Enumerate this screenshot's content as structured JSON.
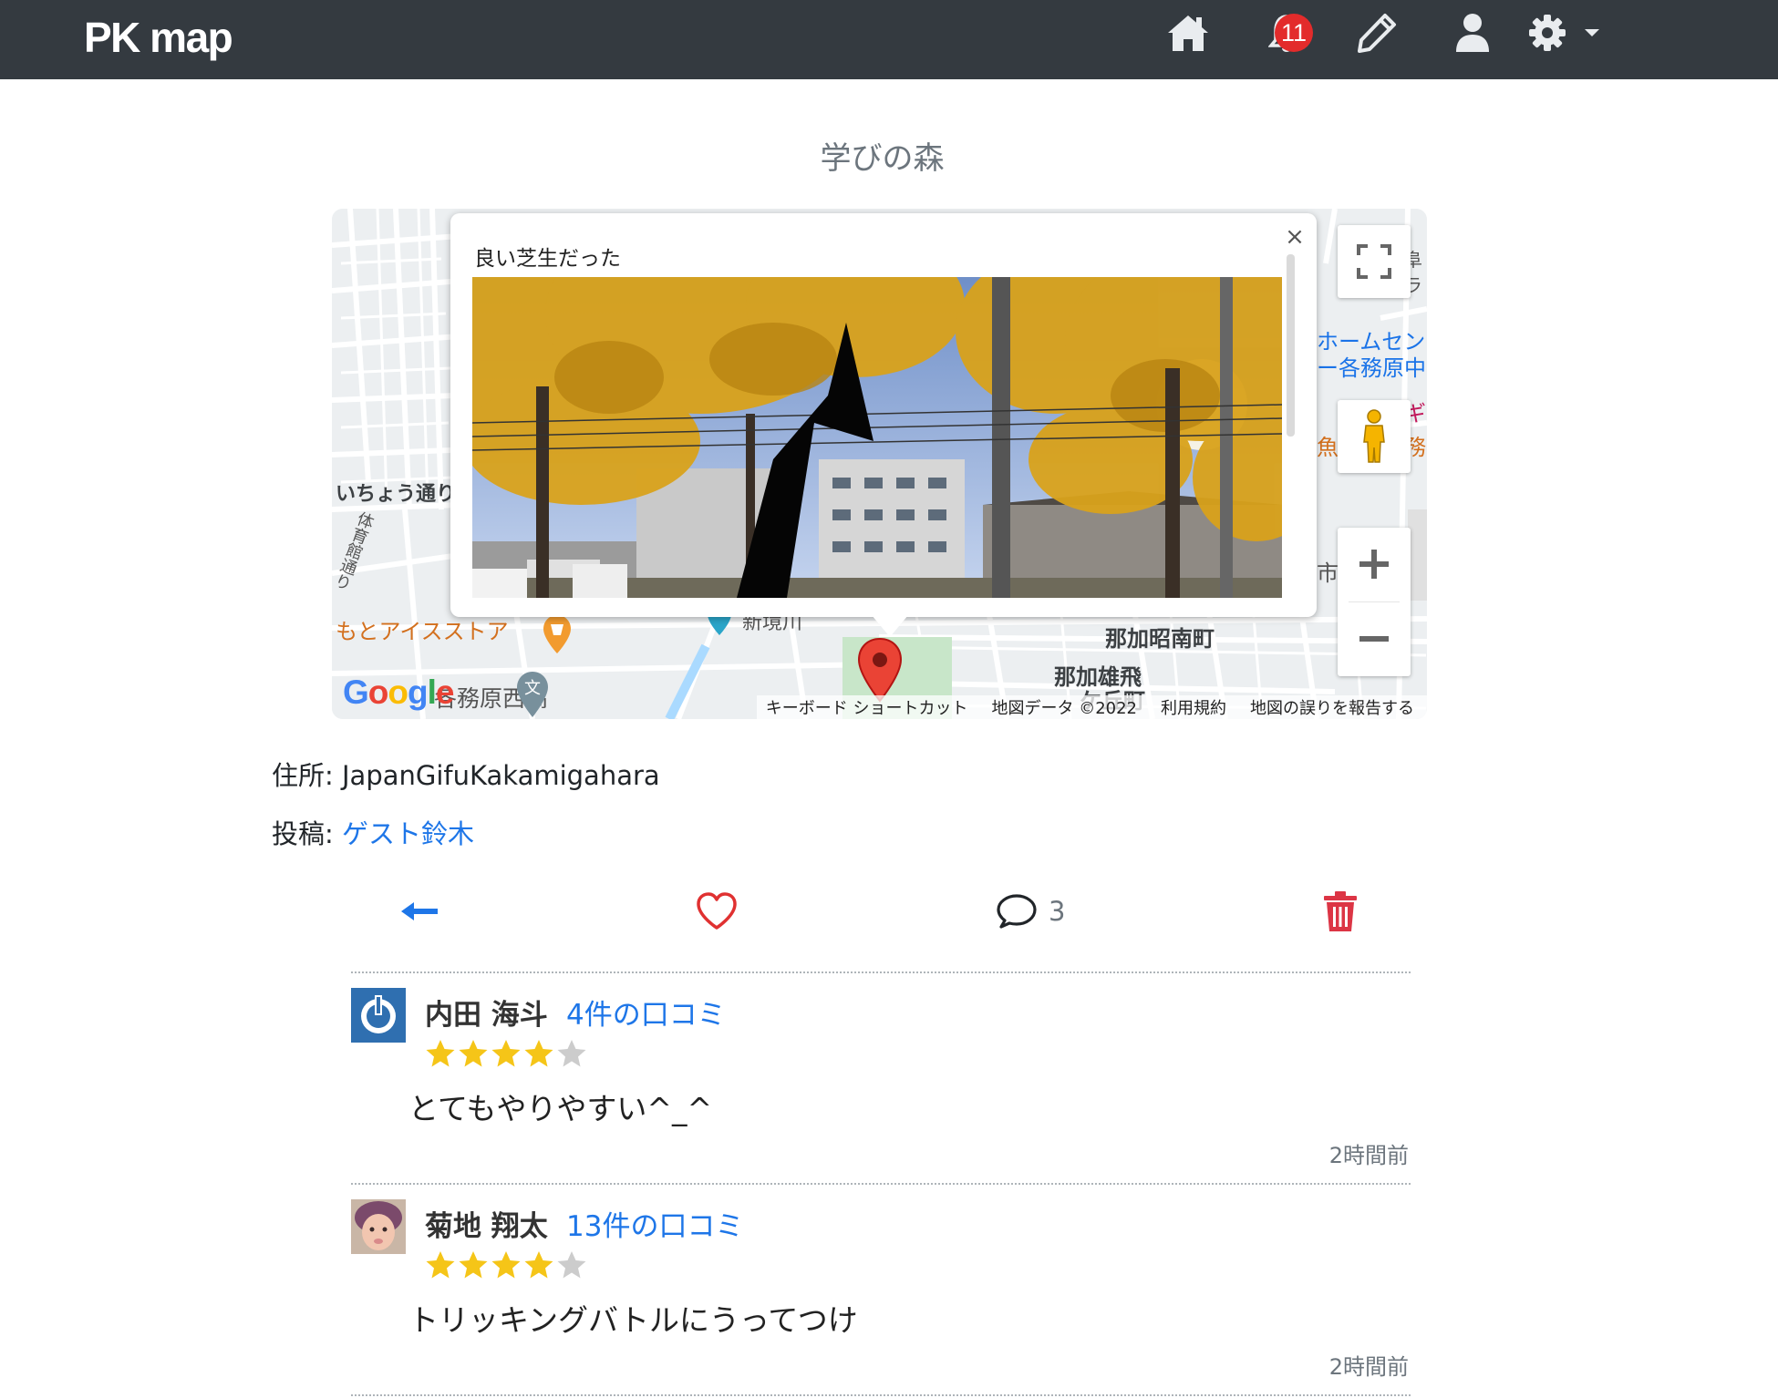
{
  "navbar": {
    "brand": "PK map",
    "notification_count": "11",
    "icons": [
      "home-icon",
      "bell-icon",
      "pencil-icon",
      "user-icon",
      "gear-icon",
      "caret-down-icon"
    ]
  },
  "spot": {
    "title": "学びの森",
    "address_label": "住所:",
    "address_value": "JapanGifuKakamigahara",
    "poster_label": "投稿:",
    "poster_name": "ゲスト鈴木",
    "comment_count": "3"
  },
  "map": {
    "infowindow_text": "良い芝生だった",
    "close_symbol": "×",
    "labels": {
      "ichou": "いちょう通り",
      "taiikukan": "体育館通り",
      "store": "もとアイスストア",
      "school": "各務原西高",
      "nakasho": "那加昭南町",
      "nakayuu": "那加雄飛",
      "okaoka": "ケ丘町",
      "home1": "ホームセン",
      "home2": "ー各務原中",
      "kinkyou": "新境川",
      "right1": "阜",
      "right2": "ラ",
      "right3": "ギ",
      "right4": "務",
      "right5": "魚",
      "right6": "市",
      "right7": "役"
    },
    "logo": "Google",
    "attribution": {
      "shortcuts": "キーボード ショートカット",
      "data": "地図データ ©2022",
      "terms": "利用規約",
      "report": "地図の誤りを報告する"
    }
  },
  "reviews": [
    {
      "name": "内田 海斗",
      "review_count": "4件の口コミ",
      "rating": 4,
      "text": "とてもやりやすい^_^",
      "time": "2時間前"
    },
    {
      "name": "菊地 翔太",
      "review_count": "13件の口コミ",
      "rating": 4,
      "text": "トリッキングバトルにうってつけ",
      "time": "2時間前"
    }
  ],
  "colors": {
    "navbar": "#343a40",
    "link": "#1e76e8",
    "heart": "#e03131",
    "trash": "#dc3545",
    "star": "#f5c518",
    "star_empty": "#cccccc",
    "badge": "#e32b2b"
  }
}
